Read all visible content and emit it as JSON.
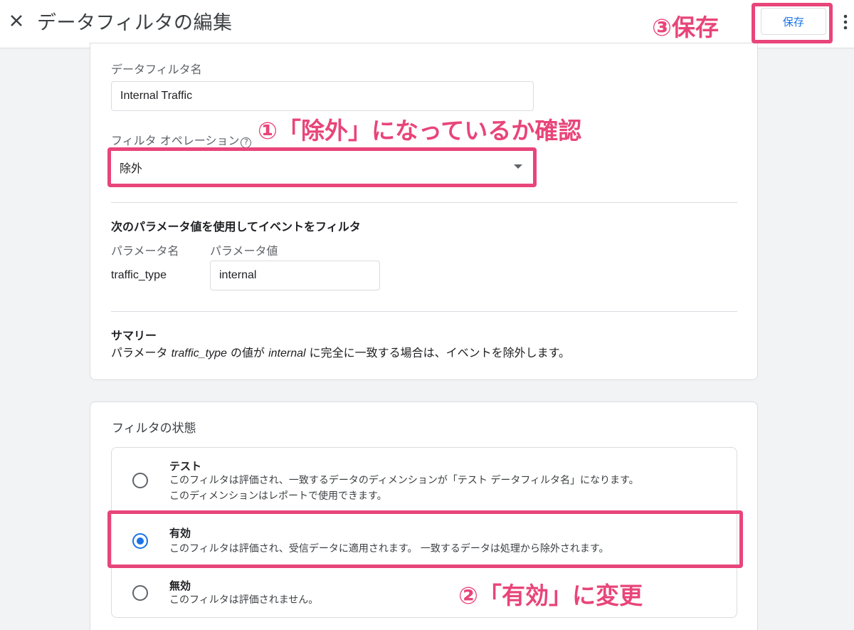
{
  "header": {
    "title": "データフィルタの編集",
    "save_label": "保存"
  },
  "filter_form": {
    "name_label": "データフィルタ名",
    "name_value": "Internal Traffic",
    "operation_label": "フィルタ オペレーション",
    "help_glyph": "?",
    "operation_value": "除外",
    "params_heading": "次のパラメータ値を使用してイベントをフィルタ",
    "param_name_header": "パラメータ名",
    "param_value_header": "パラメータ値",
    "param_name": "traffic_type",
    "param_value": "internal",
    "summary_heading": "サマリー",
    "summary": {
      "part1": "パラメータ ",
      "param_name": "traffic_type",
      "part2": " の値が ",
      "param_value": "internal",
      "part3": " に完全に一致する場合は、イベントを除外します。"
    }
  },
  "filter_state": {
    "label": "フィルタの状態",
    "selected": "有効",
    "options": [
      {
        "title": "テスト",
        "desc_line1": "このフィルタは評価され、一致するデータのディメンションが「テスト データフィルタ名」になります。",
        "desc_line2": "このディメンションはレポートで使用できます。"
      },
      {
        "title": "有効",
        "desc_line1": "このフィルタは評価され、受信データに適用されます。 一致するデータは処理から除外されます。"
      },
      {
        "title": "無効",
        "desc_line1": "このフィルタは評価されません。"
      }
    ]
  },
  "annotations": {
    "step1": "①「除外」になっているか確認",
    "step2": "②「有効」に変更",
    "step3": "③保存",
    "color": "#e8457a"
  },
  "colors": {
    "accent": "#1a73e8",
    "background": "#f1f3f4",
    "border": "#dadce0"
  },
  "icons": [
    "close-icon",
    "more-vert-icon",
    "help-icon",
    "dropdown-arrow-icon"
  ]
}
